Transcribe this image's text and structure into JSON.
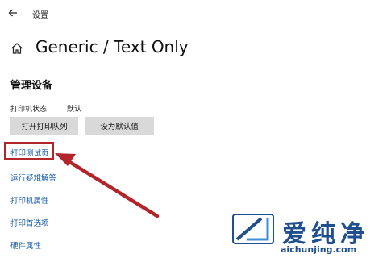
{
  "window": {
    "title": "设置"
  },
  "header": {
    "title": "Generic / Text Only"
  },
  "section": {
    "title": "管理设备",
    "status_label": "打印机状态:",
    "status_value": "默认"
  },
  "buttons": {
    "open_queue": "打开打印队列",
    "set_default": "设为默认值"
  },
  "links": {
    "print_test_page": "打印测试页",
    "run_troubleshooter": "运行疑难解答",
    "printer_properties": "打印机属性",
    "printing_preferences": "打印首选项",
    "hardware_properties": "硬件属性"
  },
  "watermark": {
    "text": "爱纯净",
    "url": "aichunjing.com"
  },
  "annotation": {
    "color": "#b3242b"
  },
  "icons": {
    "back": "back-arrow-icon",
    "home": "home-icon"
  }
}
